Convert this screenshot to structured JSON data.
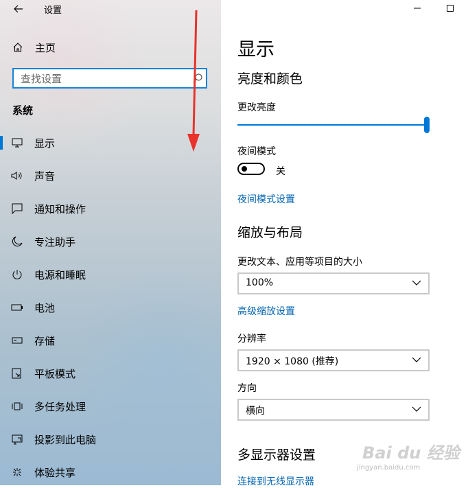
{
  "window": {
    "title": "设置"
  },
  "sidebar": {
    "home_label": "主页",
    "search_placeholder": "查找设置",
    "section_title": "系统",
    "items": [
      {
        "label": "显示",
        "icon": "monitor-icon",
        "active": true
      },
      {
        "label": "声音",
        "icon": "speaker-icon"
      },
      {
        "label": "通知和操作",
        "icon": "notification-icon"
      },
      {
        "label": "专注助手",
        "icon": "moon-icon"
      },
      {
        "label": "电源和睡眠",
        "icon": "power-icon"
      },
      {
        "label": "电池",
        "icon": "battery-icon"
      },
      {
        "label": "存储",
        "icon": "storage-icon"
      },
      {
        "label": "平板模式",
        "icon": "tablet-icon"
      },
      {
        "label": "多任务处理",
        "icon": "multitask-icon"
      },
      {
        "label": "投影到此电脑",
        "icon": "project-icon"
      },
      {
        "label": "体验共享",
        "icon": "share-icon"
      }
    ]
  },
  "main": {
    "page_title": "显示",
    "brightness_section": "亮度和颜色",
    "brightness_label": "更改亮度",
    "brightness_value": 1.0,
    "night_mode_label": "夜间模式",
    "night_mode_state": "关",
    "night_mode_settings_link": "夜间模式设置",
    "scale_section": "缩放与布局",
    "scale_label": "更改文本、应用等项目的大小",
    "scale_value": "100%",
    "advanced_scale_link": "高级缩放设置",
    "resolution_label": "分辨率",
    "resolution_value": "1920 × 1080 (推荐)",
    "orientation_label": "方向",
    "orientation_value": "横向",
    "multi_display_section": "多显示器设置",
    "wireless_display_link": "连接到无线显示器"
  },
  "watermark": {
    "text": "Bai du 经验",
    "sub": "jingyan.baidu.com"
  },
  "colors": {
    "accent": "#0078d7",
    "link": "#0063b1",
    "arrow": "#e8322b"
  }
}
